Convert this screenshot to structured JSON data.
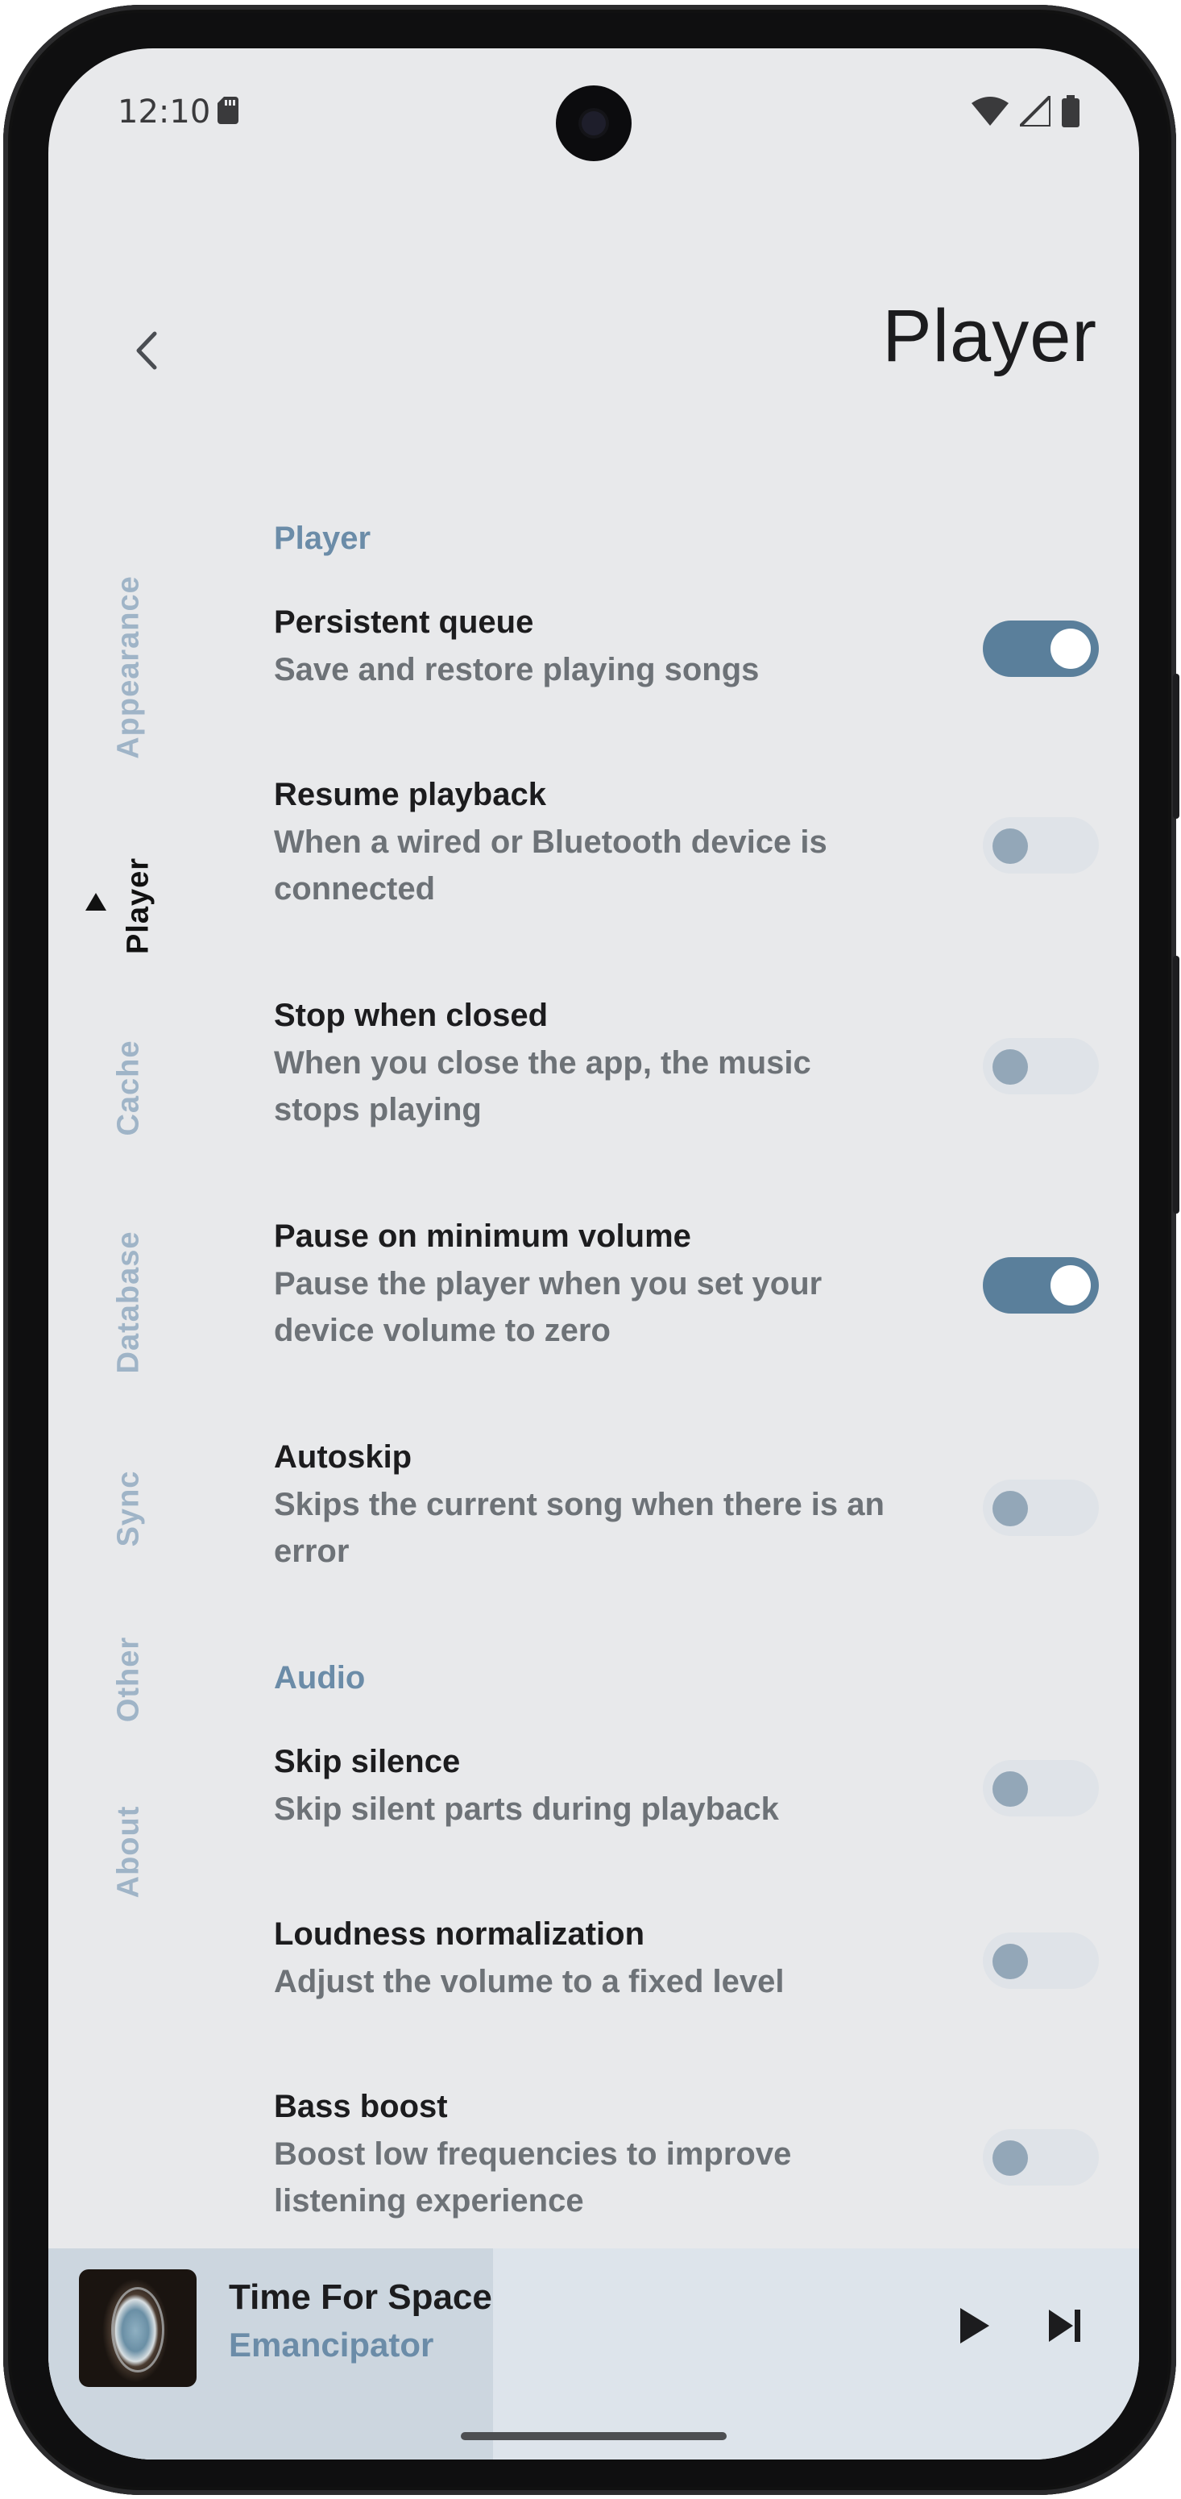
{
  "status_bar": {
    "time": "12:10",
    "icons": [
      "sd-card-icon",
      "wifi-icon",
      "signal-icon",
      "battery-icon"
    ]
  },
  "header": {
    "back_icon": "chevron-left-icon",
    "title": "Player"
  },
  "nav_rail": {
    "items": [
      {
        "label": "Appearance",
        "active": false
      },
      {
        "label": "Player",
        "active": true
      },
      {
        "label": "Cache",
        "active": false
      },
      {
        "label": "Database",
        "active": false
      },
      {
        "label": "Sync",
        "active": false
      },
      {
        "label": "Other",
        "active": false
      },
      {
        "label": "About",
        "active": false
      }
    ]
  },
  "sections": [
    {
      "title": "Player",
      "settings": [
        {
          "title": "Persistent queue",
          "description": "Save and restore playing songs",
          "enabled": true
        },
        {
          "title": "Resume playback",
          "description": "When a wired or Bluetooth device is connected",
          "enabled": false
        },
        {
          "title": "Stop when closed",
          "description": "When you close the app, the music stops playing",
          "enabled": false
        },
        {
          "title": "Pause on minimum volume",
          "description": "Pause the player when you set your device volume to zero",
          "enabled": true
        },
        {
          "title": "Autoskip",
          "description": "Skips the current song when there is an error",
          "enabled": false
        }
      ]
    },
    {
      "title": "Audio",
      "settings": [
        {
          "title": "Skip silence",
          "description": "Skip silent parts during playback",
          "enabled": false
        },
        {
          "title": "Loudness normalization",
          "description": "Adjust the volume to a fixed level",
          "enabled": false
        },
        {
          "title": "Bass boost",
          "description": "Boost low frequencies to improve listening experience",
          "enabled": false
        }
      ]
    }
  ],
  "mini_player": {
    "song_title": "Time For Space",
    "artist": "Emancipator",
    "play_icon": "play-icon",
    "next_icon": "skip-next-icon"
  },
  "colors": {
    "background": "#e8e9eb",
    "accent": "#5a7f9b",
    "section_title": "#6b8ca8",
    "nav_inactive": "#9fb4c7"
  }
}
